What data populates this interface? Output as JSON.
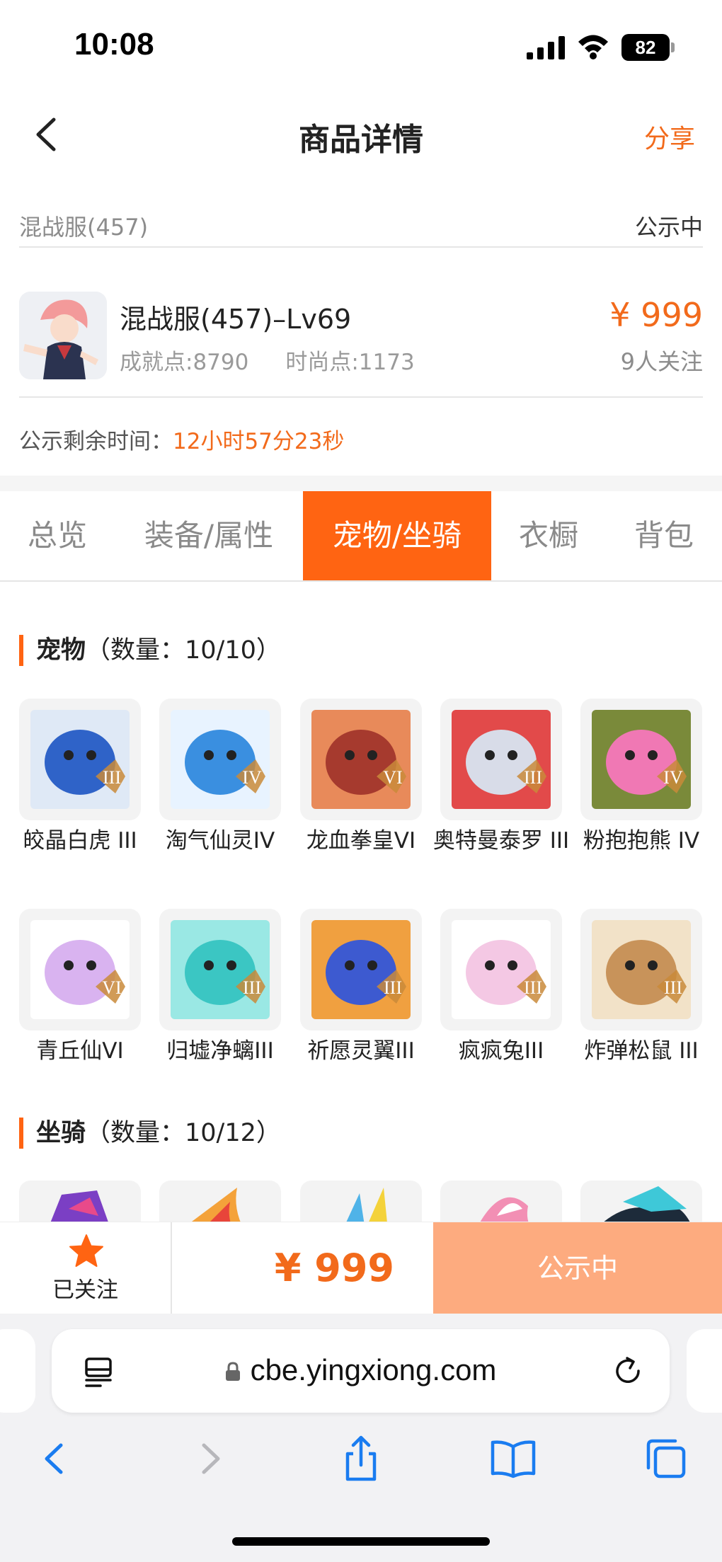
{
  "status_bar": {
    "time": "10:08",
    "battery": "82"
  },
  "nav": {
    "title": "商品详情",
    "share": "分享"
  },
  "server": {
    "name": "混战服(457)",
    "status": "公示中"
  },
  "product": {
    "name": "混战服(457)–Lv69",
    "achievement": "成就点:8790",
    "fashion": "时尚点:1173",
    "price": "¥ 999",
    "followers": "9人关注"
  },
  "countdown": {
    "label": "公示剩余时间：",
    "value": "12小时57分23秒"
  },
  "tabs": [
    {
      "label": "总览",
      "active": false
    },
    {
      "label": "装备/属性",
      "active": false
    },
    {
      "label": "宠物/坐骑",
      "active": true
    },
    {
      "label": "衣橱",
      "active": false
    },
    {
      "label": "背包",
      "active": false
    }
  ],
  "pets_section": {
    "title": "宠物",
    "count": "（数量：10/10）"
  },
  "pets": [
    {
      "name": "皎晶白虎 III",
      "rank": "III"
    },
    {
      "name": "淘气仙灵IV",
      "rank": "IV"
    },
    {
      "name": "龙血拳皇VI",
      "rank": "VI"
    },
    {
      "name": "奥特曼泰罗 III",
      "rank": "III"
    },
    {
      "name": "粉抱抱熊 IV",
      "rank": "IV"
    },
    {
      "name": "青丘仙VI",
      "rank": "VI"
    },
    {
      "name": "归墟净螭III",
      "rank": "III"
    },
    {
      "name": "祈愿灵翼III",
      "rank": "III"
    },
    {
      "name": "疯疯兔III",
      "rank": "III"
    },
    {
      "name": "炸弹松鼠 III",
      "rank": "III"
    }
  ],
  "mounts_section": {
    "title": "坐骑",
    "count": "（数量：10/12）"
  },
  "bottom_bar": {
    "follow_label": "已关注",
    "price": "¥ 999",
    "status_button": "公示中"
  },
  "browser": {
    "url": "cbe.yingxiong.com"
  },
  "colors": {
    "accent": "#ff6412",
    "price": "#f26a1b",
    "button_disabled": "#fdab7f"
  }
}
